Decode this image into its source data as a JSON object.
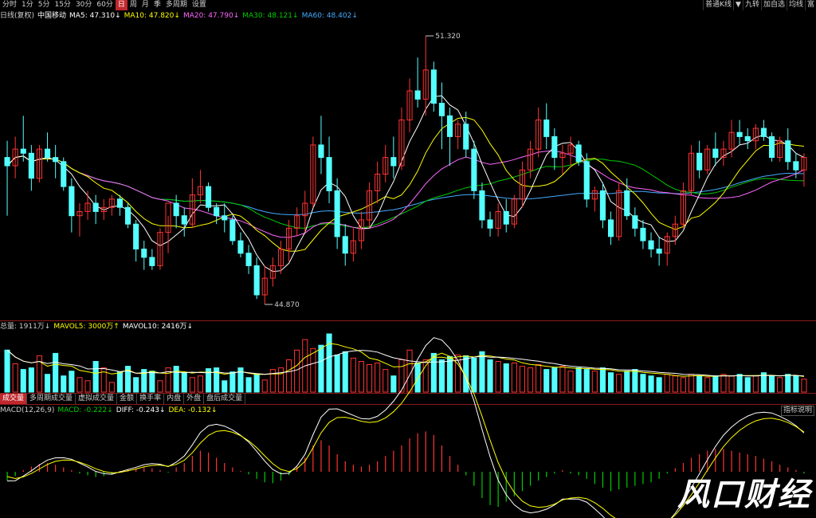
{
  "toolbar": {
    "tabs": [
      "分时",
      "1分",
      "5分",
      "15分",
      "30分",
      "60分",
      "日",
      "周",
      "月",
      "季",
      "多周期",
      "设置"
    ],
    "active_tab": "日",
    "right_buttons": [
      "普通K线",
      "▼",
      "九转",
      "加自选",
      "均线",
      "富"
    ]
  },
  "kline_header": {
    "period": "日线(复权)",
    "name": "中国移动",
    "ma5": "MA5: 47.310↓",
    "ma10": "MA10: 47.820↓",
    "ma20": "MA20: 47.790↓",
    "ma30": "MA30: 48.121↓",
    "ma60": "MA60: 48.402↓"
  },
  "volume_header": {
    "total": "总量: 1911万↓",
    "mavol5": "MAVOL5: 3000万↑",
    "mavol10": "MAVOL10: 2416万↓"
  },
  "subtabs": [
    "成交量",
    "多周期成交量",
    "虚拟成交量",
    "金额",
    "换手率",
    "内盘",
    "外盘",
    "盘后成交量"
  ],
  "active_subtab": "成交量",
  "macd_header": {
    "label": "MACD(12,26,9)",
    "macd": "MACD: -0.222↓",
    "diff": "DIFF: -0.243↓",
    "dea": "DEA: -0.132↓"
  },
  "indicator_button": "指标说明",
  "watermark": "风口财经",
  "colors": {
    "up": "#ff3333",
    "down": "#54ffff",
    "ma5": "#ffffff",
    "ma10": "#ffff00",
    "ma20": "#ff66ff",
    "ma30": "#00cc00",
    "ma60": "#44aaff"
  },
  "chart_data": {
    "type": "candlestick",
    "price_labels": {
      "high": "51.320",
      "low": "44.870"
    },
    "ohlc": [
      [
        48.4,
        48.8,
        47.0,
        48.2
      ],
      [
        48.2,
        48.9,
        47.9,
        48.6
      ],
      [
        48.6,
        49.4,
        48.3,
        48.5
      ],
      [
        48.5,
        48.7,
        47.6,
        47.9
      ],
      [
        47.9,
        48.7,
        47.8,
        48.6
      ],
      [
        48.6,
        49.0,
        48.3,
        48.4
      ],
      [
        48.4,
        48.7,
        47.9,
        48.3
      ],
      [
        48.3,
        48.4,
        47.6,
        47.7
      ],
      [
        47.7,
        47.9,
        46.6,
        47.0
      ],
      [
        47.0,
        47.3,
        46.5,
        47.1
      ],
      [
        47.1,
        47.6,
        46.9,
        47.3
      ],
      [
        47.3,
        47.5,
        46.8,
        47.1
      ],
      [
        47.1,
        47.4,
        46.9,
        47.2
      ],
      [
        47.2,
        47.5,
        47.0,
        47.4
      ],
      [
        47.4,
        47.5,
        47.0,
        47.2
      ],
      [
        47.2,
        47.3,
        46.7,
        46.8
      ],
      [
        46.8,
        46.9,
        45.9,
        46.2
      ],
      [
        46.2,
        46.4,
        45.7,
        46.0
      ],
      [
        46.0,
        46.2,
        45.7,
        45.8
      ],
      [
        45.8,
        46.7,
        45.7,
        46.6
      ],
      [
        46.6,
        47.0,
        46.1,
        47.3
      ],
      [
        47.3,
        47.5,
        46.7,
        47.0
      ],
      [
        47.0,
        47.2,
        46.5,
        46.8
      ],
      [
        46.8,
        47.9,
        46.7,
        47.5
      ],
      [
        47.5,
        48.1,
        47.3,
        47.7
      ],
      [
        47.7,
        47.8,
        47.1,
        47.2
      ],
      [
        47.2,
        47.3,
        46.8,
        47.0
      ],
      [
        47.0,
        47.3,
        46.6,
        46.9
      ],
      [
        46.9,
        47.0,
        46.3,
        46.4
      ],
      [
        46.4,
        46.6,
        46.0,
        46.1
      ],
      [
        46.1,
        46.3,
        45.6,
        45.8
      ],
      [
        45.8,
        46.0,
        45.0,
        45.1
      ],
      [
        45.1,
        45.8,
        44.87,
        45.5
      ],
      [
        45.5,
        46.0,
        45.3,
        45.8
      ],
      [
        45.8,
        46.4,
        45.6,
        46.2
      ],
      [
        46.2,
        46.9,
        45.9,
        46.7
      ],
      [
        46.7,
        47.2,
        46.5,
        47.0
      ],
      [
        47.0,
        47.6,
        46.6,
        47.3
      ],
      [
        47.3,
        48.9,
        47.2,
        48.7
      ],
      [
        48.7,
        49.4,
        48.0,
        48.4
      ],
      [
        48.4,
        48.9,
        47.3,
        47.6
      ],
      [
        47.6,
        47.9,
        46.2,
        46.5
      ],
      [
        46.5,
        46.8,
        45.8,
        46.1
      ],
      [
        46.1,
        46.7,
        45.9,
        46.4
      ],
      [
        46.4,
        47.1,
        46.2,
        46.9
      ],
      [
        46.9,
        47.8,
        46.7,
        47.6
      ],
      [
        47.6,
        48.3,
        47.3,
        48.0
      ],
      [
        48.0,
        48.7,
        47.8,
        48.4
      ],
      [
        48.4,
        48.9,
        47.9,
        48.2
      ],
      [
        48.2,
        49.6,
        48.1,
        49.3
      ],
      [
        49.3,
        50.3,
        49.0,
        50.0
      ],
      [
        50.0,
        50.8,
        49.6,
        49.8
      ],
      [
        49.8,
        51.32,
        49.4,
        50.5
      ],
      [
        50.5,
        50.7,
        49.5,
        49.7
      ],
      [
        49.7,
        50.2,
        48.6,
        49.4
      ],
      [
        49.4,
        49.6,
        48.2,
        48.9
      ],
      [
        48.9,
        49.3,
        48.6,
        49.2
      ],
      [
        49.2,
        49.5,
        48.4,
        48.6
      ],
      [
        48.6,
        48.8,
        47.4,
        47.6
      ],
      [
        47.6,
        47.8,
        46.7,
        46.9
      ],
      [
        46.9,
        47.1,
        46.5,
        46.7
      ],
      [
        46.7,
        47.3,
        46.5,
        47.1
      ],
      [
        47.1,
        47.4,
        46.6,
        46.8
      ],
      [
        46.8,
        47.5,
        46.7,
        47.4
      ],
      [
        47.4,
        48.3,
        47.2,
        48.1
      ],
      [
        48.1,
        48.8,
        47.9,
        48.6
      ],
      [
        48.6,
        49.6,
        48.4,
        49.3
      ],
      [
        49.3,
        49.7,
        48.6,
        48.9
      ],
      [
        48.9,
        49.1,
        48.1,
        48.4
      ],
      [
        48.4,
        48.7,
        48.0,
        48.5
      ],
      [
        48.5,
        48.9,
        48.2,
        48.7
      ],
      [
        48.7,
        48.8,
        48.2,
        48.3
      ],
      [
        48.3,
        48.5,
        47.2,
        47.4
      ],
      [
        47.4,
        47.7,
        47.1,
        47.6
      ],
      [
        47.6,
        47.8,
        46.7,
        46.9
      ],
      [
        46.9,
        47.1,
        46.3,
        46.5
      ],
      [
        46.5,
        47.8,
        46.4,
        47.6
      ],
      [
        47.6,
        47.9,
        46.9,
        47.0
      ],
      [
        47.0,
        47.2,
        46.5,
        46.7
      ],
      [
        46.7,
        46.9,
        46.2,
        46.4
      ],
      [
        46.4,
        46.6,
        46.0,
        46.2
      ],
      [
        46.2,
        46.5,
        45.8,
        46.1
      ],
      [
        46.1,
        46.6,
        45.8,
        46.5
      ],
      [
        46.5,
        47.0,
        46.3,
        46.8
      ],
      [
        46.8,
        47.8,
        46.7,
        47.6
      ],
      [
        47.6,
        48.7,
        47.5,
        48.5
      ],
      [
        48.5,
        48.8,
        47.9,
        48.1
      ],
      [
        48.1,
        48.7,
        48.0,
        48.6
      ],
      [
        48.6,
        49.0,
        48.2,
        48.4
      ],
      [
        48.4,
        48.8,
        48.2,
        48.6
      ],
      [
        48.6,
        49.3,
        48.4,
        49.0
      ],
      [
        49.0,
        49.3,
        48.7,
        48.9
      ],
      [
        48.9,
        49.1,
        48.6,
        48.8
      ],
      [
        48.8,
        49.2,
        48.6,
        49.1
      ],
      [
        49.1,
        49.3,
        48.8,
        48.9
      ],
      [
        48.9,
        49.0,
        48.3,
        48.4
      ],
      [
        48.4,
        48.9,
        48.3,
        48.8
      ],
      [
        48.8,
        49.1,
        48.1,
        48.3
      ],
      [
        48.3,
        48.5,
        47.9,
        48.1
      ],
      [
        48.1,
        48.5,
        47.7,
        48.4
      ]
    ],
    "volume": [
      52,
      35,
      28,
      30,
      45,
      22,
      48,
      20,
      26,
      18,
      14,
      38,
      30,
      12,
      25,
      32,
      18,
      28,
      26,
      14,
      30,
      32,
      24,
      18,
      20,
      29,
      30,
      14,
      25,
      30,
      18,
      22,
      15,
      28,
      30,
      40,
      52,
      65,
      54,
      58,
      72,
      46,
      50,
      42,
      38,
      34,
      36,
      28,
      20,
      40,
      52,
      36,
      40,
      48,
      40,
      44,
      46,
      45,
      42,
      50,
      40,
      38,
      35,
      36,
      32,
      30,
      34,
      28,
      30,
      32,
      26,
      30,
      28,
      26,
      30,
      24,
      22,
      26,
      28,
      22,
      20,
      18,
      22,
      20,
      18,
      22,
      20,
      18,
      20,
      22,
      20,
      22,
      18,
      20,
      24,
      20,
      18,
      22,
      20,
      16
    ],
    "macd_hist": [
      -0.1,
      -0.05,
      0.02,
      0.06,
      0.09,
      0.1,
      0.08,
      0.05,
      0.02,
      -0.02,
      -0.04,
      -0.06,
      -0.05,
      -0.03,
      0.01,
      0.03,
      0.04,
      0.05,
      0.04,
      0.02,
      -0.01,
      0.05,
      0.1,
      0.18,
      0.24,
      0.22,
      0.16,
      0.1,
      0.05,
      0.01,
      -0.03,
      -0.08,
      -0.12,
      -0.13,
      -0.1,
      -0.04,
      0.06,
      0.16,
      0.3,
      0.36,
      0.3,
      0.2,
      0.12,
      0.08,
      0.06,
      0.08,
      0.12,
      0.18,
      0.24,
      0.3,
      0.38,
      0.44,
      0.46,
      0.42,
      0.3,
      0.18,
      0.08,
      -0.04,
      -0.16,
      -0.3,
      -0.38,
      -0.4,
      -0.34,
      -0.28,
      -0.22,
      -0.16,
      -0.1,
      -0.06,
      -0.02,
      0.02,
      -0.02,
      -0.04,
      -0.08,
      -0.14,
      -0.18,
      -0.22,
      -0.2,
      -0.18,
      -0.16,
      -0.14,
      -0.12,
      -0.08,
      -0.02,
      0.04,
      0.1,
      0.16,
      0.2,
      0.24,
      0.26,
      0.26,
      0.24,
      0.22,
      0.2,
      0.18,
      0.15,
      0.12,
      0.08,
      0.05,
      0.02,
      -0.02
    ],
    "ma5_dir": "down"
  }
}
